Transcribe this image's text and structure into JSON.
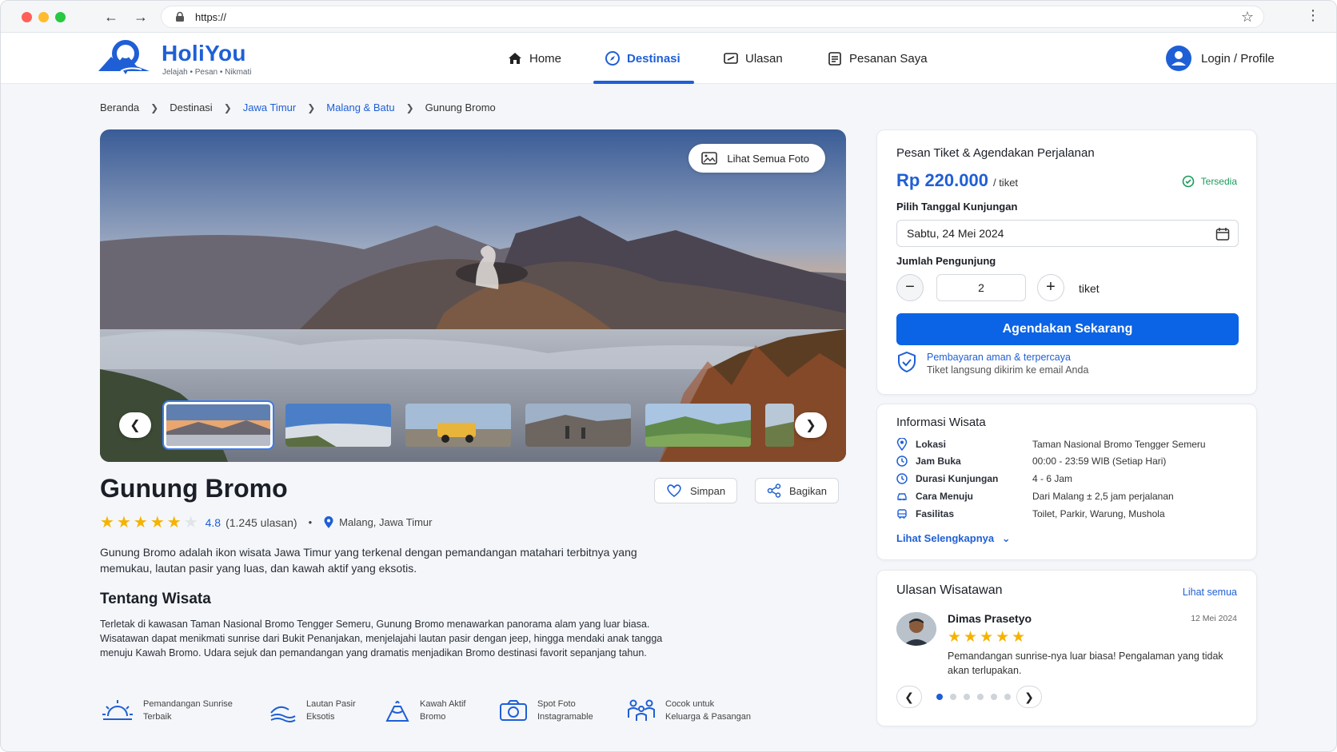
{
  "browser": {
    "url": "https://"
  },
  "brand": {
    "name": "HoliYou",
    "tagline": "Jelajah • Pesan • Nikmati"
  },
  "nav": [
    {
      "label": "Home"
    },
    {
      "label": "Destinasi"
    },
    {
      "label": "Ulasan"
    },
    {
      "label": "Pesanan Saya"
    }
  ],
  "login_label": "Login / Profile",
  "breadcrumb": [
    "Beranda",
    "Destinasi",
    "Jawa Timur",
    "Malang & Batu",
    "Gunung Bromo"
  ],
  "hero": {
    "photos_button": "Lihat Semua Foto"
  },
  "destination": {
    "title": "Gunung Bromo",
    "save_label": "Simpan",
    "share_label": "Bagikan",
    "rating": "4.8",
    "rating_value": 4.8,
    "reviews": "(1.245 ulasan)",
    "bullet": "•",
    "location": "Malang, Jawa Timur",
    "description": "Gunung Bromo adalah ikon wisata Jawa Timur yang terkenal dengan pemandangan matahari terbitnya yang memukau, lautan pasir yang luas, dan kawah aktif yang eksotis.",
    "about_title": "Tentang Wisata",
    "about_text": "Terletak di kawasan Taman Nasional Bromo Tengger Semeru, Gunung Bromo menawarkan panorama alam yang luar biasa. Wisatawan dapat menikmati sunrise dari Bukit Penanjakan, menjelajahi lautan pasir dengan jeep, hingga mendaki anak tangga menuju Kawah Bromo. Udara sejuk dan pemandangan yang dramatis menjadikan Bromo destinasi favorit sepanjang tahun.",
    "features": [
      {
        "l1": "Pemandangan Sunrise",
        "l2": "Terbaik"
      },
      {
        "l1": "Lautan Pasir",
        "l2": "Eksotis"
      },
      {
        "l1": "Kawah Aktif",
        "l2": "Bromo"
      },
      {
        "l1": "Spot Foto",
        "l2": "Instagramable"
      },
      {
        "l1": "Cocok untuk",
        "l2": "Keluarga & Pasangan"
      }
    ]
  },
  "booking": {
    "title": "Pesan Tiket & Agendakan Perjalanan",
    "price": "Rp 220.000",
    "per": "/ tiket",
    "status": "Tersedia",
    "date_label": "Pilih Tanggal Kunjungan",
    "date_value": "Sabtu, 24 Mei 2024",
    "qty_label": "Jumlah Pengunjung",
    "qty_value": "2",
    "minus": "−",
    "plus": "+",
    "qty_unit": "tiket",
    "book_label": "Agendakan Sekarang",
    "secure_title": "Pembayaran aman & terpercaya",
    "secure_sub": "Tiket langsung dikirim ke email Anda"
  },
  "info": {
    "title": "Informasi Wisata",
    "rows": [
      {
        "k": "Lokasi",
        "v": "Taman Nasional Bromo Tengger Semeru"
      },
      {
        "k": "Jam Buka",
        "v": "00:00 - 23:59 WIB (Setiap Hari)"
      },
      {
        "k": "Durasi Kunjungan",
        "v": "4 - 6 Jam"
      },
      {
        "k": "Cara Menuju",
        "v": "Dari Malang ± 2,5 jam perjalanan"
      },
      {
        "k": "Fasilitas",
        "v": "Toilet, Parkir, Warung, Mushola"
      }
    ],
    "more": "Lihat Selengkapnya"
  },
  "reviews": {
    "title": "Ulasan Wisatawan",
    "see_all": "Lihat semua",
    "name": "Dimas Prasetyo",
    "date": "12 Mei 2024",
    "stars": "★★★★★",
    "text": "Pemandangan sunrise-nya luar biasa! Pengalaman yang tidak akan terlupakan.",
    "page_count": 6,
    "active_page": 1
  },
  "colors": {
    "primary": "#1f5fd6",
    "button": "#0b63e5",
    "star": "#f5b301",
    "success": "#1a9a5a"
  },
  "icons": [
    "home-icon",
    "compass-icon",
    "review-icon",
    "orders-icon",
    "user-icon",
    "image-icon",
    "heart-icon",
    "share-icon",
    "pin-icon",
    "calendar-icon",
    "shield-icon",
    "clock-icon",
    "car-icon",
    "bus-icon",
    "sunrise-icon",
    "dune-icon",
    "volcano-icon",
    "camera-icon",
    "family-icon"
  ]
}
